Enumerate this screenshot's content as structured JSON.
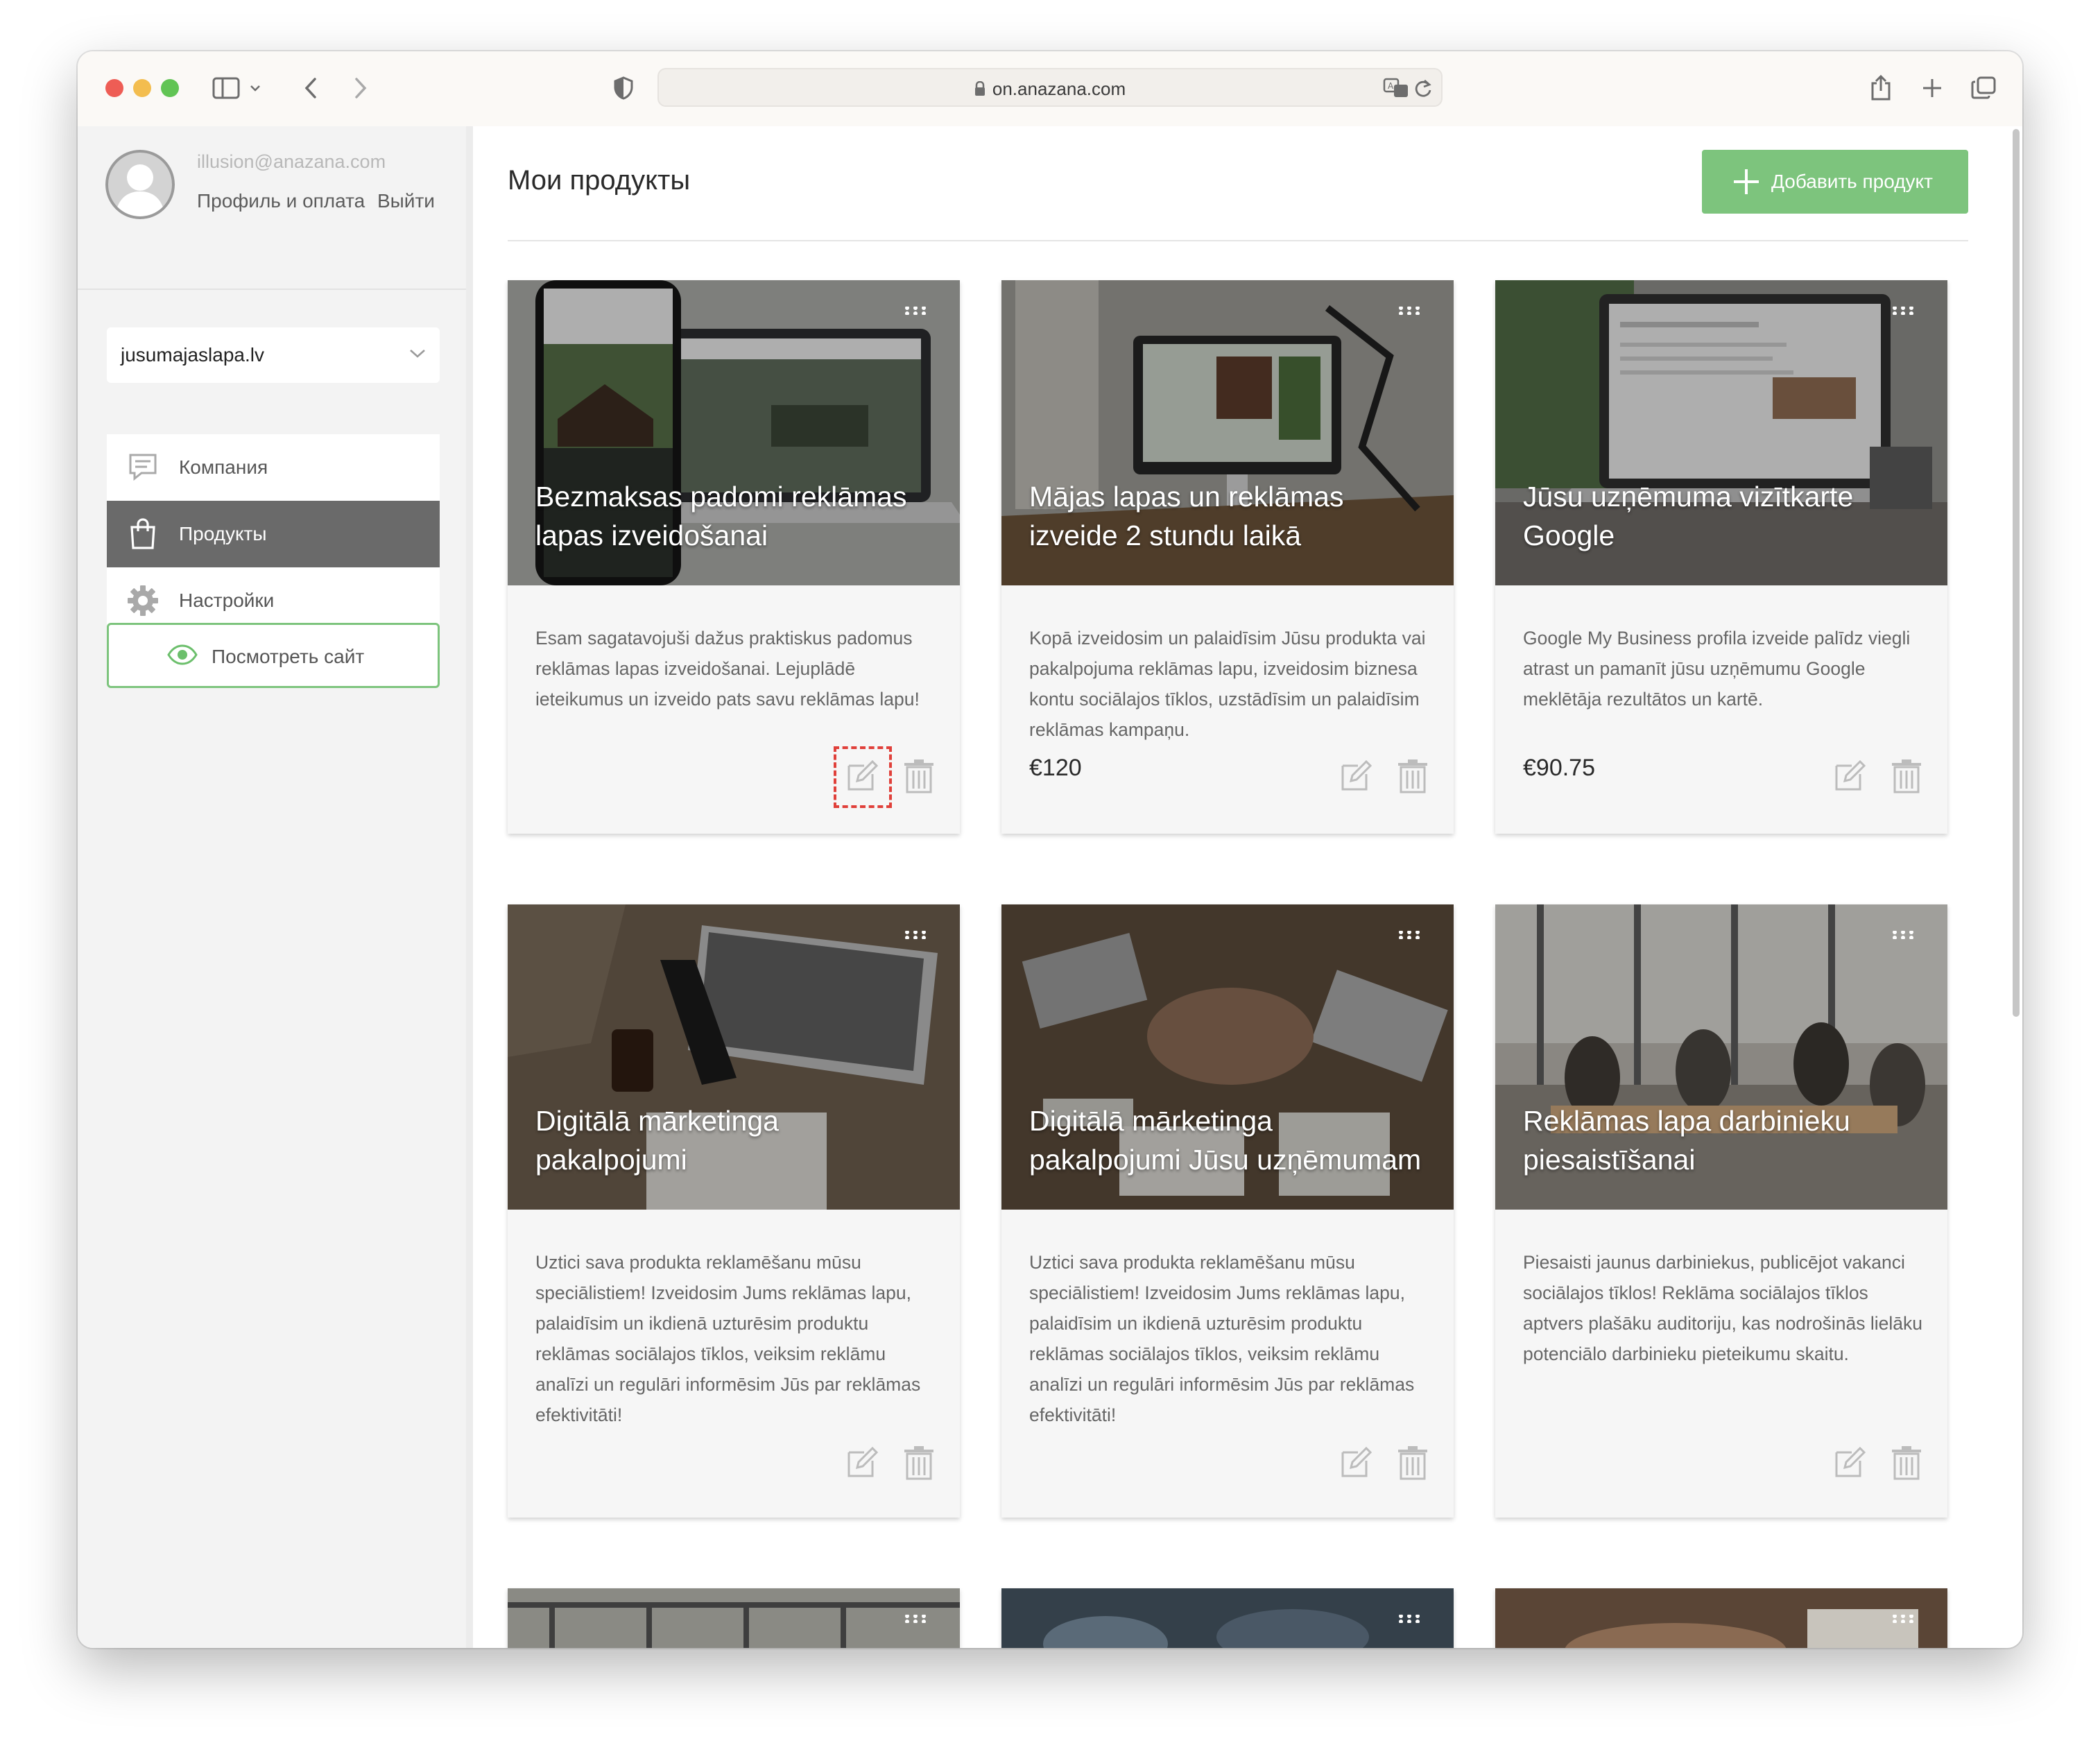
{
  "browser": {
    "url": "on.anazana.com"
  },
  "sidebar": {
    "email": "illusion@anazana.com",
    "profile_link": "Профиль и оплата",
    "logout_link": "Выйти",
    "site_select": "jusumajaslapa.lv",
    "nav": [
      {
        "label": "Компания",
        "icon": "chat-icon"
      },
      {
        "label": "Продукты",
        "icon": "bag-icon",
        "active": true
      },
      {
        "label": "Настройки",
        "icon": "gear-icon"
      }
    ],
    "view_site_button": "Посмотреть сайт"
  },
  "main": {
    "title": "Мои продукты",
    "add_button": "Добавить продукт",
    "cards": [
      {
        "title": "Bezmaksas padomi reklāmas lapas izveidošanai",
        "description": "Esam sagatavojuši dažus praktiskus padomus reklāmas lapas izveidošanai. Lejuplādē ieteikumus un izveido pats savu reklāmas lapu!",
        "price": ""
      },
      {
        "title": "Mājas lapas un reklāmas izveide 2 stundu laikā",
        "description": "Kopā izveidosim un palaidīsim Jūsu produkta vai pakalpojuma reklāmas lapu, izveidosim biznesa kontu sociālajos tīklos, uzstādīsim un palaidīsim reklāmas kampaņu.",
        "price": "€120"
      },
      {
        "title": "Jūsu uzņēmuma vizītkarte Google",
        "description": "Google My Business profila izveide palīdz viegli atrast un pamanīt jūsu uzņēmumu Google meklētāja rezultātos un kartē.",
        "price": "€90.75"
      },
      {
        "title": "Digitālā mārketinga pakalpojumi",
        "description": "Uztici sava produkta reklamēšanu mūsu speciālistiem! Izveidosim Jums reklāmas lapu, palaidīsim un ikdienā uzturēsim produktu reklāmas sociālajos tīklos, veiksim reklāmu analīzi un regulāri informēsim Jūs par reklāmas efektivitāti!",
        "price": ""
      },
      {
        "title": "Digitālā mārketinga pakalpojumi Jūsu uzņēmumam",
        "description": "Uztici sava produkta reklamēšanu mūsu speciālistiem! Izveidosim Jums reklāmas lapu, palaidīsim un ikdienā uzturēsim produktu reklāmas sociālajos tīklos, veiksim reklāmu analīzi un regulāri informēsim Jūs par reklāmas efektivitāti!",
        "price": ""
      },
      {
        "title": "Reklāmas lapa darbinieku piesaistīšanai",
        "description": "Piesaisti jaunus darbiniekus, publicējot vakanci sociālajos tīklos! Reklāma sociālajos tīklos aptvers plašāku auditoriju, kas nodrošinās lielāku potenciālo darbinieku pieteikumu skaitu.",
        "price": ""
      }
    ]
  },
  "colors": {
    "accent_green": "#7dc47d",
    "active_nav": "#6a6a6a",
    "focus_outline": "#e0403a"
  }
}
